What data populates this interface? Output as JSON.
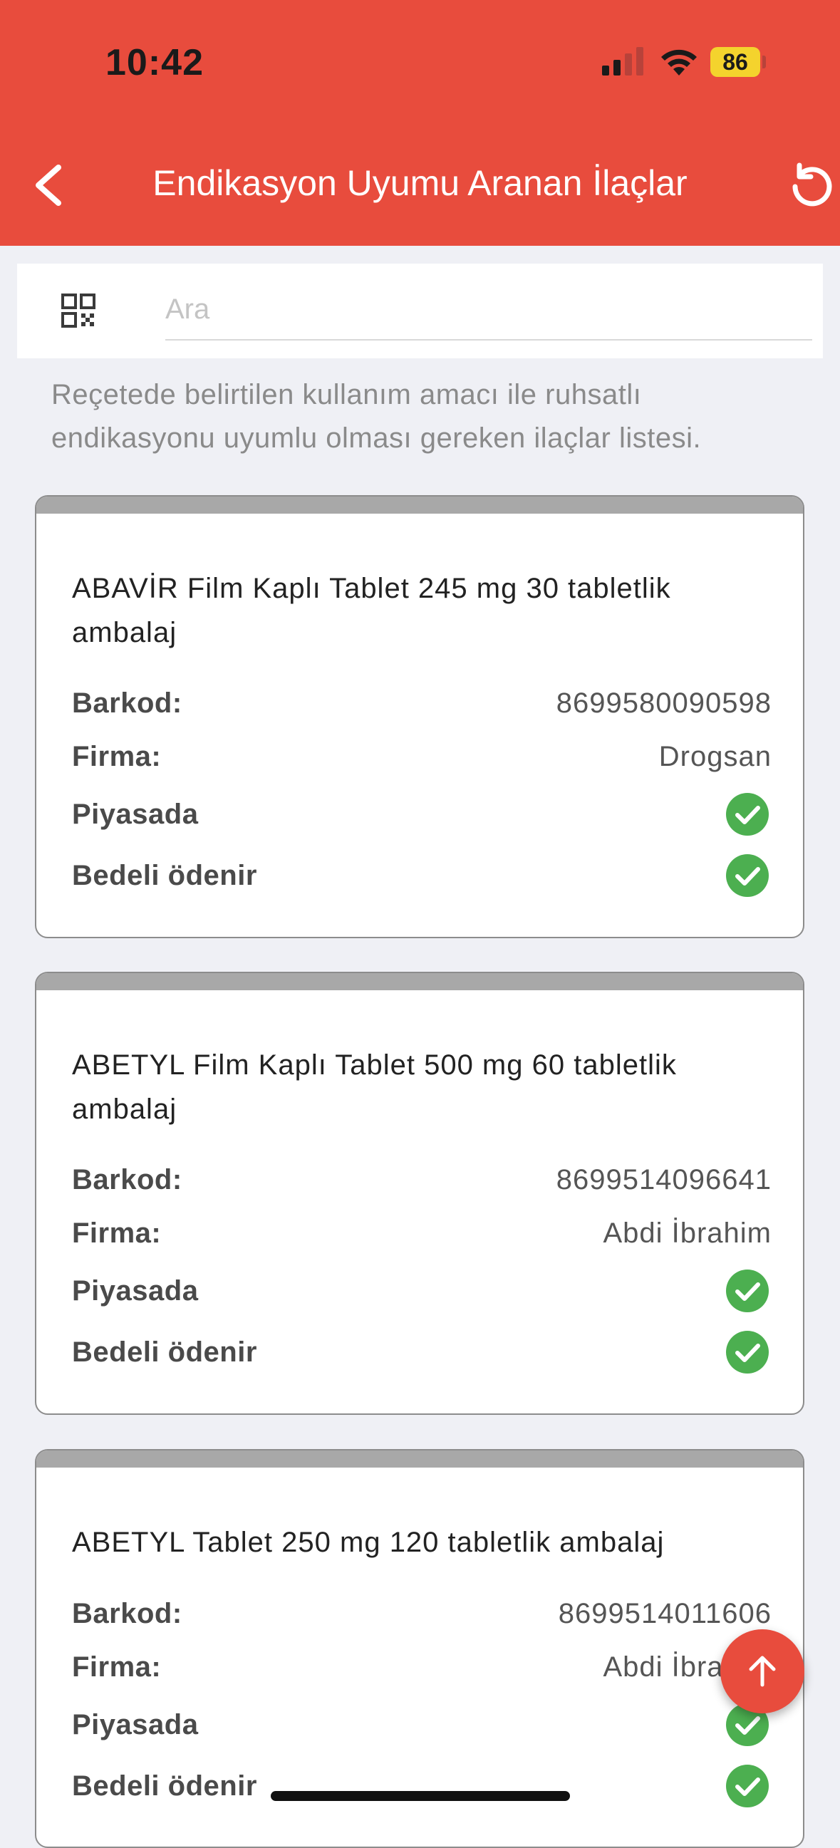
{
  "status_bar": {
    "time": "10:42",
    "battery": "86"
  },
  "header": {
    "title": "Endikasyon Uyumu Aranan İlaçlar"
  },
  "search": {
    "placeholder": "Ara"
  },
  "description": "Reçetede belirtilen kullanım amacı ile ruhsatlı endikasyonu uyumlu olması gereken ilaçlar listesi.",
  "labels": {
    "barkod": "Barkod:",
    "firma": "Firma:",
    "piyasada": "Piyasada",
    "bedeli": "Bedeli ödenir"
  },
  "drugs": [
    {
      "name": "ABAVİR Film Kaplı Tablet 245 mg 30 tabletlik ambalaj",
      "barcode": "8699580090598",
      "company": "Drogsan",
      "on_market": true,
      "reimbursed": true
    },
    {
      "name": "ABETYL Film Kaplı Tablet 500 mg 60 tabletlik ambalaj",
      "barcode": "8699514096641",
      "company": "Abdi İbrahim",
      "on_market": true,
      "reimbursed": true
    },
    {
      "name": "ABETYL Tablet 250 mg 120 tabletlik ambalaj",
      "barcode": "8699514011606",
      "company": "Abdi İbrahim",
      "on_market": true,
      "reimbursed": true
    }
  ],
  "colors": {
    "accent": "#e84c3d",
    "check": "#4caf50",
    "background": "#eff0f5"
  },
  "icons": [
    "back-arrow-icon",
    "refresh-icon",
    "qr-code-icon",
    "check-circle-icon",
    "arrow-up-icon"
  ]
}
